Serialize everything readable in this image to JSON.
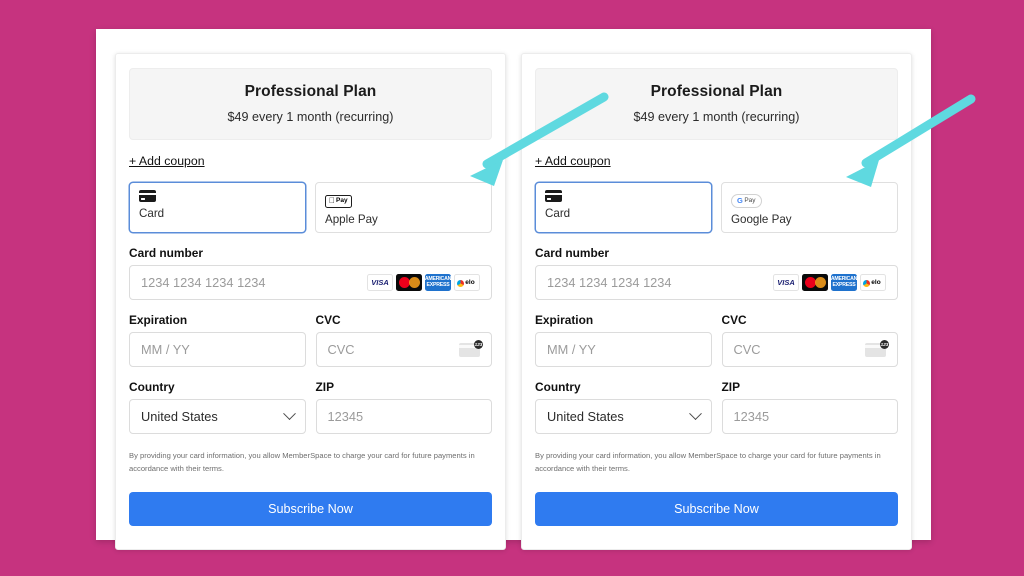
{
  "theme": {
    "background_color": "#c6337f",
    "page_color": "#ffffff",
    "accent_button_color": "#2f7bf0",
    "selected_border_color": "#5b8dd9",
    "arrow_color": "#5fd9e0"
  },
  "cards": [
    {
      "id": "apple-pay-variant",
      "plan": {
        "title": "Professional Plan",
        "price": "$49 every 1 month (recurring)"
      },
      "coupon_link": "+ Add coupon",
      "methods": [
        {
          "id": "card",
          "label": "Card",
          "icon": "credit-card-icon",
          "selected": true
        },
        {
          "id": "apple-pay",
          "label": "Apple Pay",
          "icon": "apple-pay-badge-icon",
          "badge_text": "Pay",
          "selected": false
        }
      ],
      "fields": {
        "card_number_label": "Card number",
        "card_number_placeholder": "1234 1234 1234 1234",
        "expiration_label": "Expiration",
        "expiration_placeholder": "MM / YY",
        "cvc_label": "CVC",
        "cvc_placeholder": "CVC",
        "country_label": "Country",
        "country_value": "United States",
        "zip_label": "ZIP",
        "zip_placeholder": "12345"
      },
      "brands": [
        {
          "name": "visa",
          "text": "VISA"
        },
        {
          "name": "mastercard",
          "text": ""
        },
        {
          "name": "amex",
          "text": "AMERICAN EXPRESS"
        },
        {
          "name": "elo",
          "text": "elo"
        }
      ],
      "legal": "By providing your card information, you allow MemberSpace to charge your card for future payments in accordance with their terms.",
      "submit_label": "Subscribe Now"
    },
    {
      "id": "google-pay-variant",
      "plan": {
        "title": "Professional Plan",
        "price": "$49 every 1 month (recurring)"
      },
      "coupon_link": "+ Add coupon",
      "methods": [
        {
          "id": "card",
          "label": "Card",
          "icon": "credit-card-icon",
          "selected": true
        },
        {
          "id": "google-pay",
          "label": "Google Pay",
          "icon": "google-pay-badge-icon",
          "badge_text": "Pay",
          "selected": false
        }
      ],
      "fields": {
        "card_number_label": "Card number",
        "card_number_placeholder": "1234 1234 1234 1234",
        "expiration_label": "Expiration",
        "expiration_placeholder": "MM / YY",
        "cvc_label": "CVC",
        "cvc_placeholder": "CVC",
        "country_label": "Country",
        "country_value": "United States",
        "zip_label": "ZIP",
        "zip_placeholder": "12345"
      },
      "brands": [
        {
          "name": "visa",
          "text": "VISA"
        },
        {
          "name": "mastercard",
          "text": ""
        },
        {
          "name": "amex",
          "text": "AMERICAN EXPRESS"
        },
        {
          "name": "elo",
          "text": "elo"
        }
      ],
      "legal": "By providing your card information, you allow MemberSpace to charge your card for future payments in accordance with their terms.",
      "submit_label": "Subscribe Now"
    }
  ],
  "annotations": [
    {
      "id": "arrow-apple-pay",
      "shape": "arrow",
      "points_to": "apple-pay-tab"
    },
    {
      "id": "arrow-google-pay",
      "shape": "arrow",
      "points_to": "google-pay-tab"
    }
  ]
}
